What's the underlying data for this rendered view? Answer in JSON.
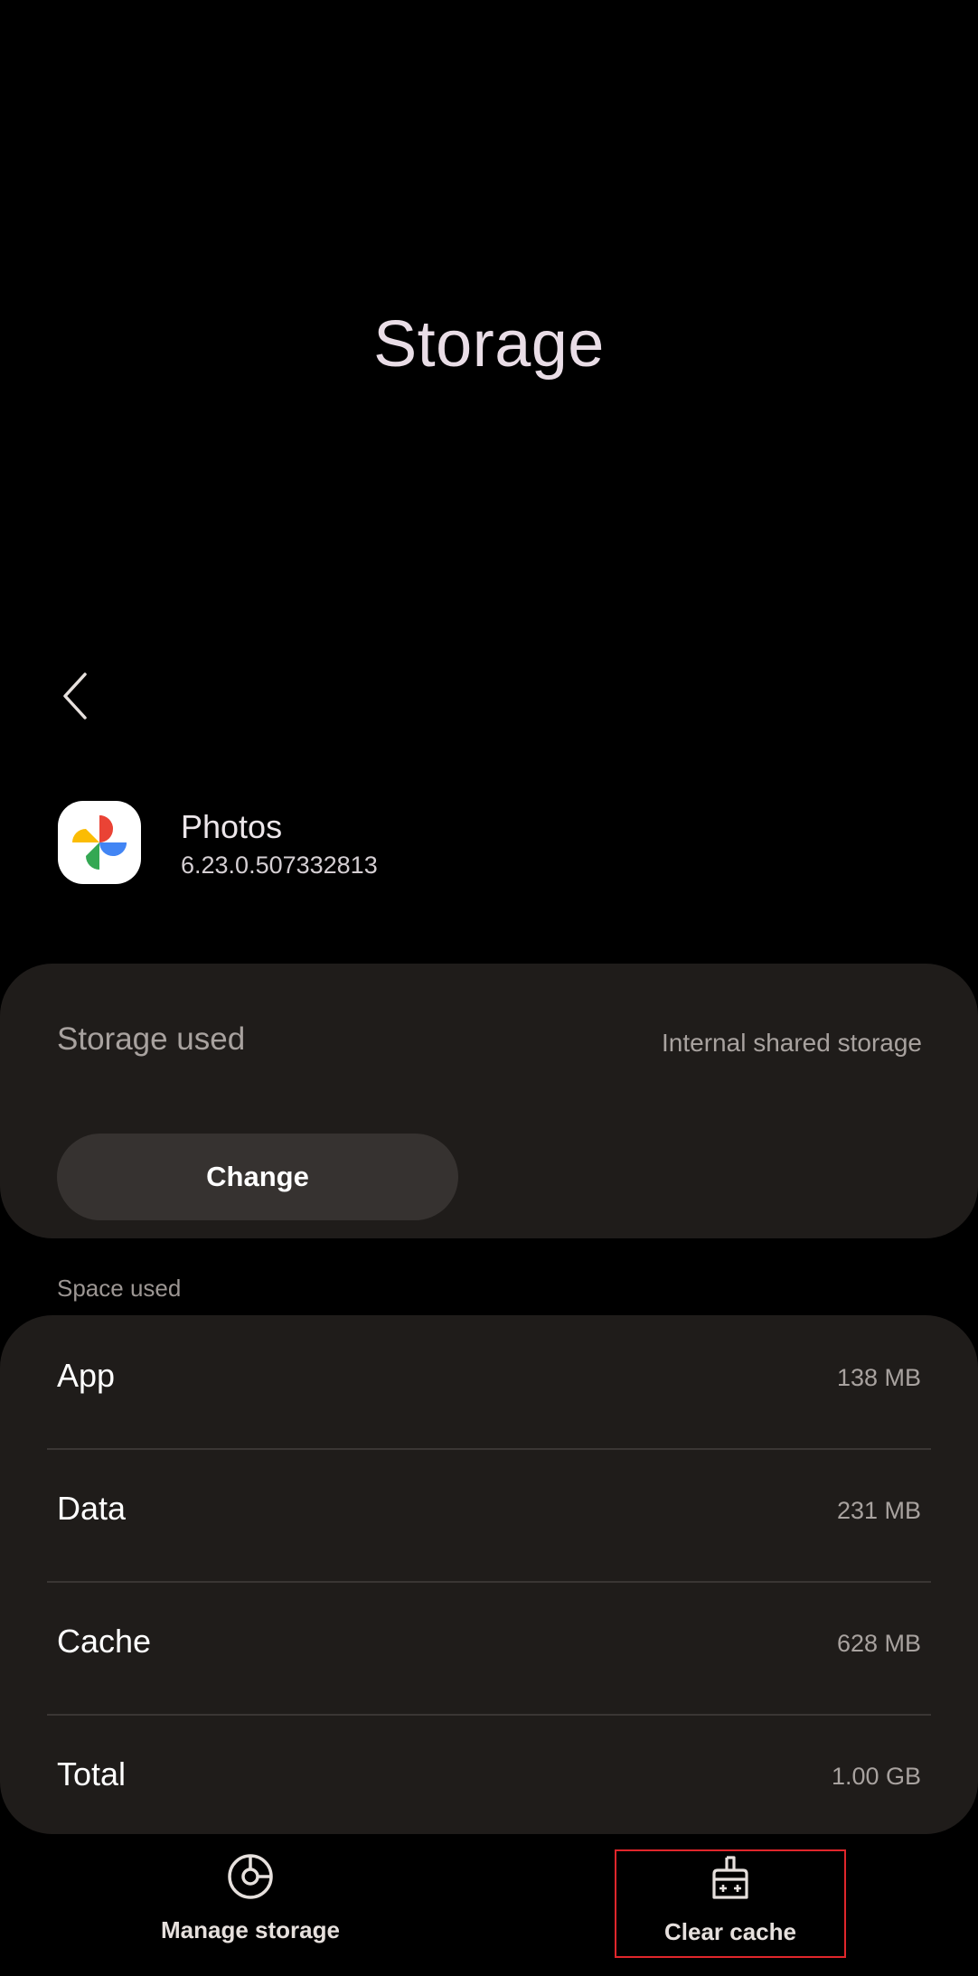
{
  "page": {
    "title": "Storage"
  },
  "app": {
    "name": "Photos",
    "version": "6.23.0.507332813"
  },
  "storage_card": {
    "label": "Storage used",
    "location": "Internal shared storage",
    "change_label": "Change"
  },
  "space_used": {
    "section_label": "Space used",
    "rows": [
      {
        "label": "App",
        "value": "138 MB"
      },
      {
        "label": "Data",
        "value": "231 MB"
      },
      {
        "label": "Cache",
        "value": "628 MB"
      },
      {
        "label": "Total",
        "value": "1.00 GB"
      }
    ]
  },
  "bottom_bar": {
    "manage_storage": {
      "label": "Manage storage",
      "icon": "pie-chart-icon"
    },
    "clear_cache": {
      "label": "Clear cache",
      "icon": "broom-icon"
    }
  },
  "colors": {
    "background": "#000000",
    "card": "#1f1c1a",
    "title": "#e9dde6",
    "highlight": "#e0262b"
  }
}
